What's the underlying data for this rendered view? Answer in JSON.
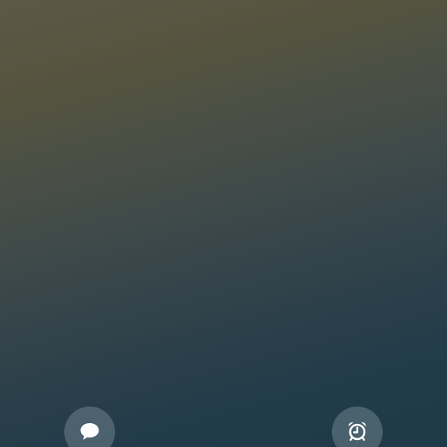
{
  "screen": {
    "background_top": "#5e5846",
    "background_bottom": "#1f3a48"
  },
  "shortcuts": [
    {
      "icon": "chat-bubble-icon"
    },
    {
      "icon": "alarm-clock-icon"
    }
  ]
}
